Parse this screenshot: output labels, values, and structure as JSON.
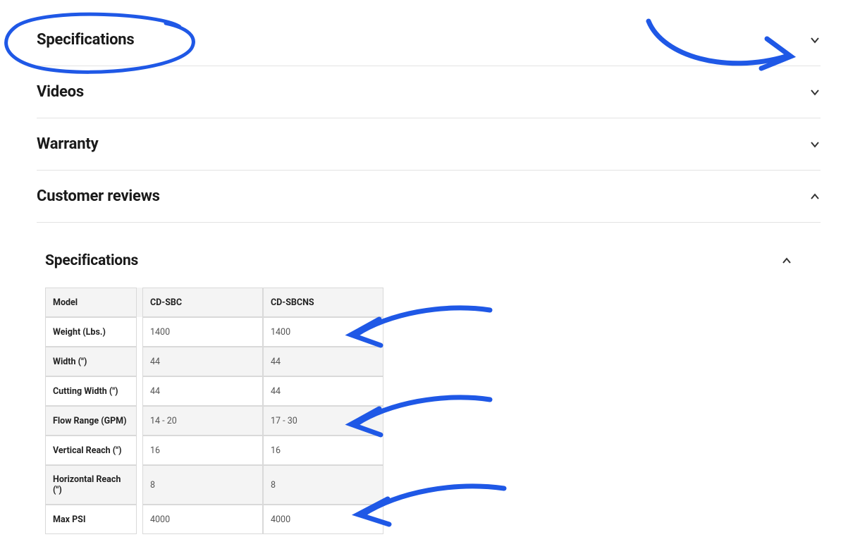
{
  "accordion": {
    "specifications": {
      "title": "Specifications",
      "expanded": false
    },
    "videos": {
      "title": "Videos",
      "expanded": false
    },
    "warranty": {
      "title": "Warranty",
      "expanded": false
    },
    "reviews": {
      "title": "Customer reviews",
      "expanded": true
    }
  },
  "specOpen": {
    "title": "Specifications",
    "expanded": true,
    "columns": [
      "CD-SBC",
      "CD-SBCNS"
    ],
    "rowLabel": "Model",
    "rows": [
      {
        "label": "Weight (Lbs.)",
        "values": [
          "1400",
          "1400"
        ]
      },
      {
        "label": "Width (\")",
        "values": [
          "44",
          "44"
        ]
      },
      {
        "label": "Cutting Width (\")",
        "values": [
          "44",
          "44"
        ]
      },
      {
        "label": "Flow Range (GPM)",
        "values": [
          "14 - 20",
          "17 - 30"
        ]
      },
      {
        "label": "Vertical Reach (\")",
        "values": [
          "16",
          "16"
        ]
      },
      {
        "label": "Horizontal Reach (\")",
        "values": [
          "8",
          "8"
        ]
      },
      {
        "label": "Max PSI",
        "values": [
          "4000",
          "4000"
        ]
      }
    ]
  },
  "annotationColor": "#1f58e6"
}
